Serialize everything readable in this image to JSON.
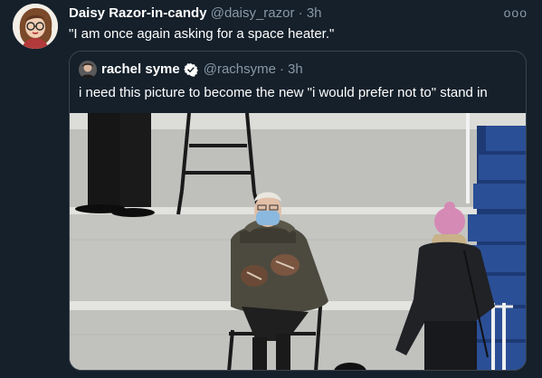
{
  "tweet": {
    "display_name": "Daisy Razor-in-candy",
    "handle": "@daisy_razor",
    "separator": "·",
    "time": "3h",
    "more_label": "ooo",
    "text": "\"I am once again asking for a space heater.\""
  },
  "quoted": {
    "display_name": "rachel syme",
    "verified": true,
    "handle": "@rachsyme",
    "separator": "·",
    "time": "3h",
    "text": "i need this picture to become the new \"i would prefer not to\" stand in"
  },
  "colors": {
    "background": "#15202b",
    "text": "#ffffff",
    "secondary_text": "#8899a6",
    "border": "#38444d",
    "verified": "#ffffff"
  },
  "icons": {
    "more": "more-horizontal-icon",
    "verified": "verified-badge-icon"
  }
}
